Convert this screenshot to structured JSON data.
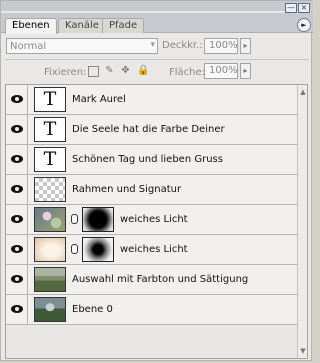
{
  "tabs": [
    "Ebenen",
    "Kanäle",
    "Pfade"
  ],
  "window_buttons": [
    "—",
    "×"
  ],
  "panel_menu_icon": "►",
  "blend_mode": "Normal",
  "opacity": {
    "label": "Deckkr.:",
    "value": "100%"
  },
  "lock": {
    "label": "Fixieren:",
    "icons": [
      "transparency-lock-icon",
      "brush-lock-icon",
      "move-lock-icon",
      "padlock-icon"
    ]
  },
  "fill": {
    "label": "Fläche:",
    "value": "100%"
  },
  "layers": [
    {
      "name": "Mark Aurel",
      "thumb": "T"
    },
    {
      "name": "Die Seele hat die Farbe Deiner",
      "thumb": "T"
    },
    {
      "name": "Schönen  Tag und  lieben Gruss",
      "thumb": "T"
    },
    {
      "name": "Rahmen und Signatur",
      "thumb": ""
    },
    {
      "name": "weiches Licht",
      "thumb": ""
    },
    {
      "name": "weiches Licht",
      "thumb": ""
    },
    {
      "name": "Auswahl mit Farbton und Sättigung",
      "thumb": ""
    },
    {
      "name": "Ebene 0",
      "thumb": ""
    }
  ],
  "scroll": {
    "up": "▲",
    "down": "▼"
  },
  "accent": "#111111"
}
